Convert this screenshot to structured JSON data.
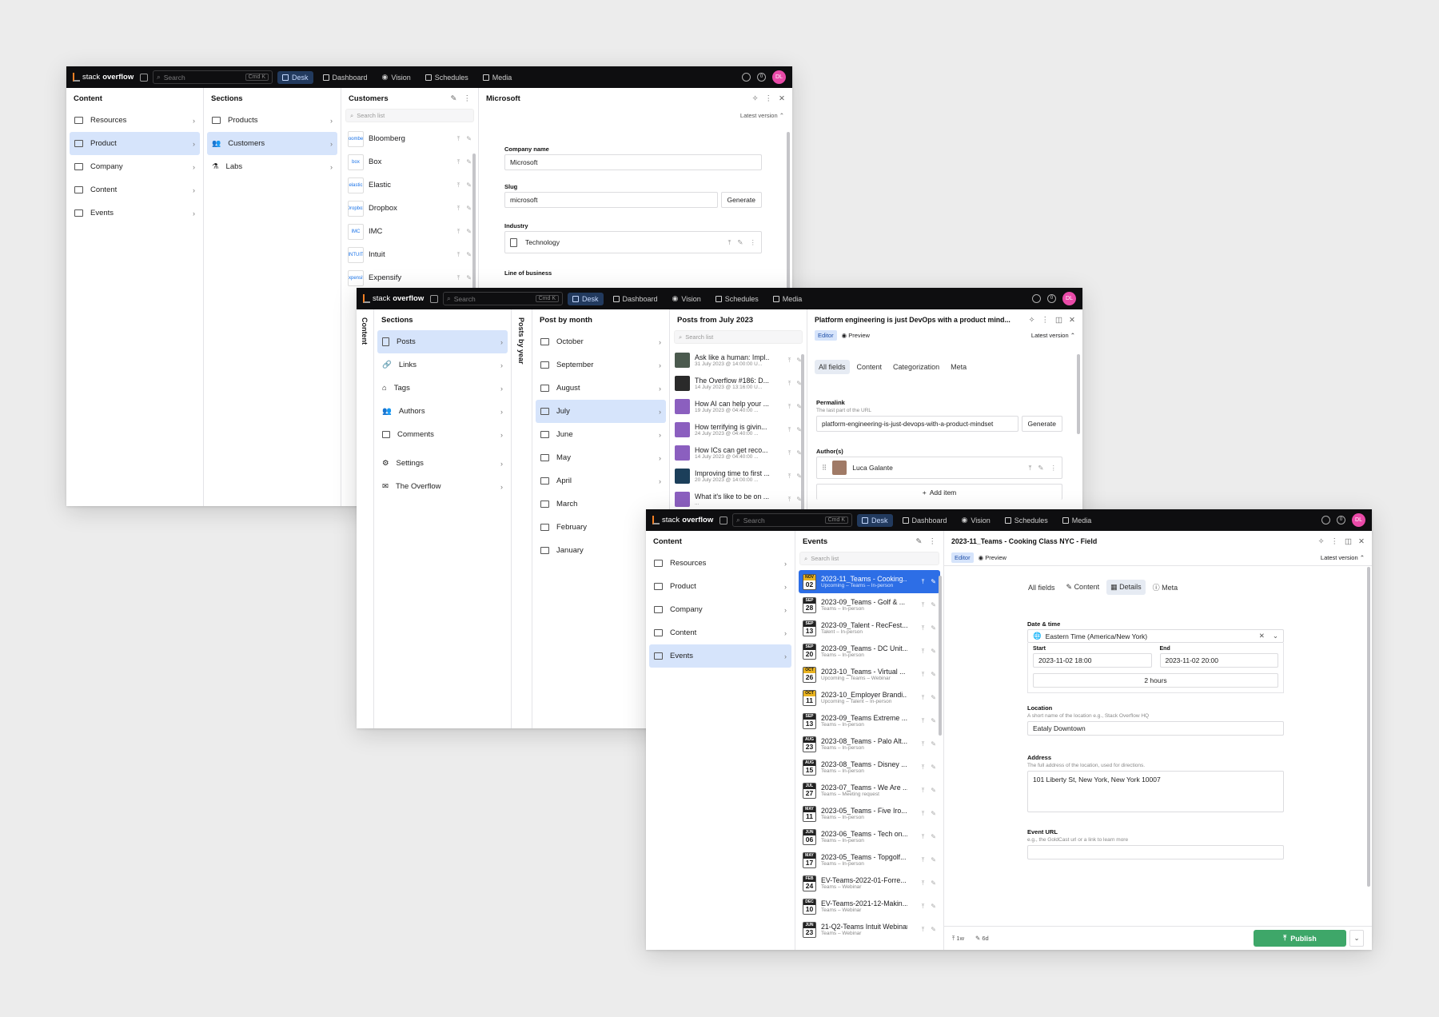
{
  "common": {
    "logo_pre": "stack",
    "logo_bold": "overflow",
    "search_placeholder": "Search",
    "shortcut": "Cmd K",
    "nav": [
      "Desk",
      "Dashboard",
      "Vision",
      "Schedules",
      "Media"
    ],
    "avatar": "DL",
    "notif": "0"
  },
  "w1": {
    "content": {
      "title": "Content",
      "items": [
        "Resources",
        "Product",
        "Company",
        "Content",
        "Events"
      ]
    },
    "sections": {
      "title": "Sections",
      "items": [
        "Products",
        "Customers",
        "Labs"
      ]
    },
    "customers": {
      "title": "Customers",
      "search": "Search list",
      "items": [
        {
          "name": "Bloomberg",
          "logo": "Bloomberg"
        },
        {
          "name": "Box",
          "logo": "box"
        },
        {
          "name": "Elastic",
          "logo": "elastic"
        },
        {
          "name": "Dropbox",
          "logo": "Dropbox"
        },
        {
          "name": "IMC",
          "logo": "IMC"
        },
        {
          "name": "Intuit",
          "logo": "INTUIT"
        },
        {
          "name": "Expensify",
          "logo": "Expensify"
        }
      ]
    },
    "doc": {
      "title": "Microsoft",
      "version": "Latest version",
      "company_label": "Company name",
      "company_value": "Microsoft",
      "slug_label": "Slug",
      "slug_value": "microsoft",
      "generate": "Generate",
      "industry_label": "Industry",
      "industry_value": "Technology",
      "lob_label": "Line of business"
    }
  },
  "w2": {
    "collapsed_content": "Content",
    "sections": {
      "title": "Sections",
      "items": [
        "Posts",
        "Links",
        "Tags",
        "Authors",
        "Comments",
        "Settings",
        "The Overflow"
      ]
    },
    "collapsed_year": "Posts by year",
    "month": {
      "title": "Post by month",
      "items": [
        "October",
        "September",
        "August",
        "July",
        "June",
        "May",
        "April",
        "March",
        "February",
        "January"
      ]
    },
    "posts": {
      "title": "Posts from July 2023",
      "search": "Search list",
      "items": [
        {
          "t": "Ask like a human: Impl...",
          "s": "31 July 2023 @ 14:00:00 U..."
        },
        {
          "t": "The Overflow #186: D...",
          "s": "14 July 2023 @ 13:16:00 U..."
        },
        {
          "t": "How AI can help your ...",
          "s": "19 July 2023 @ 04:40:00 ..."
        },
        {
          "t": "How terrifying is givin...",
          "s": "24 July 2023 @ 04:40:00 ..."
        },
        {
          "t": "How ICs can get reco...",
          "s": "14 July 2023 @ 04:40:00 ..."
        },
        {
          "t": "Improving time to first ...",
          "s": "20 July 2023 @ 14:00:00 ..."
        },
        {
          "t": "What it's like to be on ...",
          "s": "..."
        }
      ]
    },
    "doc": {
      "title": "Platform engineering is just DevOps with a product mind...",
      "editor": "Editor",
      "preview": "Preview",
      "version": "Latest version",
      "tabs": [
        "All fields",
        "Content",
        "Categorization",
        "Meta"
      ],
      "permalink_label": "Permalink",
      "permalink_sub": "The last part of the URL",
      "permalink_value": "platform-engineering-is-just-devops-with-a-product-mindset",
      "generate": "Generate",
      "authors_label": "Author(s)",
      "author": "Luca Galante",
      "add_item": "Add item"
    }
  },
  "w3": {
    "content": {
      "title": "Content",
      "items": [
        "Resources",
        "Product",
        "Company",
        "Content",
        "Events"
      ]
    },
    "events": {
      "title": "Events",
      "search": "Search list",
      "items": [
        {
          "mo": "NOV",
          "d": "02",
          "up": true,
          "t": "2023-11_Teams - Cooking...",
          "s": "Upcoming – Teams – In-person"
        },
        {
          "mo": "SEP",
          "d": "28",
          "up": false,
          "t": "2023-09_Teams - Golf & ...",
          "s": "Teams – In-person"
        },
        {
          "mo": "SEP",
          "d": "13",
          "up": false,
          "t": "2023-09_Talent - RecFest...",
          "s": "Talent – In-person"
        },
        {
          "mo": "SEP",
          "d": "20",
          "up": false,
          "t": "2023-09_Teams - DC Unit...",
          "s": "Teams – In-person"
        },
        {
          "mo": "OCT",
          "d": "26",
          "up": true,
          "t": "2023-10_Teams - Virtual ...",
          "s": "Upcoming – Teams – Webinar"
        },
        {
          "mo": "OCT",
          "d": "11",
          "up": true,
          "t": "2023-10_Employer Brandi...",
          "s": "Upcoming – Talent – In-person"
        },
        {
          "mo": "SEP",
          "d": "13",
          "up": false,
          "t": "2023-09_Teams Extreme ...",
          "s": "Teams – In-person"
        },
        {
          "mo": "AUG",
          "d": "23",
          "up": false,
          "t": "2023-08_Teams - Palo Alt...",
          "s": "Teams – In-person"
        },
        {
          "mo": "AUG",
          "d": "15",
          "up": false,
          "t": "2023-08_Teams - Disney ...",
          "s": "Teams – In-person"
        },
        {
          "mo": "JUL",
          "d": "27",
          "up": false,
          "t": "2023-07_Teams - We Are ...",
          "s": "Teams – Meeting request"
        },
        {
          "mo": "MAY",
          "d": "11",
          "up": false,
          "t": "2023-05_Teams - Five Iro...",
          "s": "Teams – In-person"
        },
        {
          "mo": "JUN",
          "d": "06",
          "up": false,
          "t": "2023-06_Teams - Tech on...",
          "s": "Teams – In-person"
        },
        {
          "mo": "MAY",
          "d": "17",
          "up": false,
          "t": "2023-05_Teams - Topgolf...",
          "s": "Teams – In-person"
        },
        {
          "mo": "FEB",
          "d": "24",
          "up": false,
          "t": "EV-Teams-2022-01-Forre...",
          "s": "Teams – Webinar"
        },
        {
          "mo": "DEC",
          "d": "10",
          "up": false,
          "t": "EV-Teams-2021-12-Makin...",
          "s": "Teams – Webinar"
        },
        {
          "mo": "JUN",
          "d": "23",
          "up": false,
          "t": "21-Q2-Teams Intuit Webinar",
          "s": "Teams – Webinar"
        }
      ]
    },
    "doc": {
      "title": "2023-11_Teams - Cooking Class NYC - Field",
      "editor": "Editor",
      "preview": "Preview",
      "version": "Latest version",
      "tabs": [
        "All fields",
        "Content",
        "Details",
        "Meta"
      ],
      "dt_label": "Date & time",
      "tz": "Eastern Time (America/New York)",
      "start_label": "Start",
      "start": "2023-11-02 18:00",
      "end_label": "End",
      "end": "2023-11-02 20:00",
      "duration": "2 hours",
      "loc_label": "Location",
      "loc_sub": "A short name of the location e.g., Stack Overflow HQ",
      "loc": "Eataly Downtown",
      "addr_label": "Address",
      "addr_sub": "The full address of the location, used for directions.",
      "addr": "101 Liberty St, New York, New York  10007",
      "url_label": "Event URL",
      "url_sub": "e.g., the GoldCast url or a link to learn more",
      "foot_a": "1w",
      "foot_b": "6d",
      "publish": "Publish"
    }
  }
}
